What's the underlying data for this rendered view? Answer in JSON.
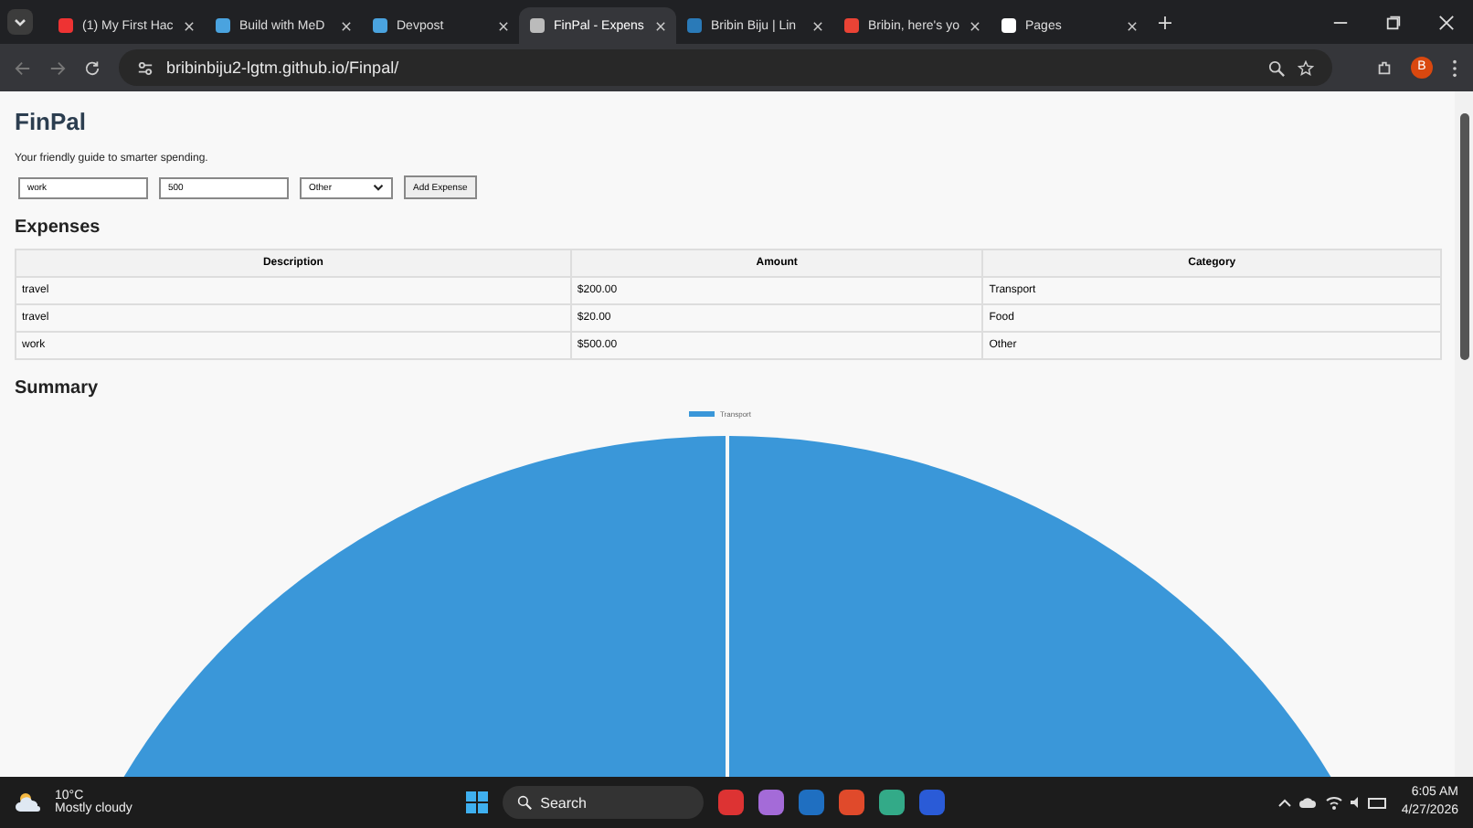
{
  "browser": {
    "tabs": [
      {
        "title": "(1) My First Hac",
        "selected": false
      },
      {
        "title": "Build with MeD",
        "selected": false
      },
      {
        "title": "Devpost",
        "selected": false
      },
      {
        "title": "FinPal - Expens",
        "selected": true
      },
      {
        "title": "Bribin Biju | Lin",
        "selected": false
      },
      {
        "title": "Bribin, here's yo",
        "selected": false
      },
      {
        "title": "Pages",
        "selected": false
      }
    ],
    "url": "bribinbiju2-lgtm.github.io/Finpal/",
    "profile": "B"
  },
  "page": {
    "title": "FinPal",
    "subtitle": "Your friendly guide to smarter spending.",
    "form": {
      "description": "work",
      "amount": "500",
      "category": "Other",
      "button": "Add Expense"
    },
    "expenses_heading": "Expenses",
    "table": {
      "columns": [
        "Description",
        "Amount",
        "Category"
      ],
      "rows": [
        [
          "travel",
          "$200.00",
          "Transport"
        ],
        [
          "travel",
          "$20.00",
          "Food"
        ],
        [
          "work",
          "$500.00",
          "Other"
        ]
      ]
    },
    "summary_heading": "Summary",
    "legend": "Transport"
  },
  "taskbar": {
    "weather_temp": "10°C",
    "weather_text": "Mostly cloudy",
    "search": "Search",
    "time": "6:05 AM",
    "date": "4/27/2026"
  }
}
